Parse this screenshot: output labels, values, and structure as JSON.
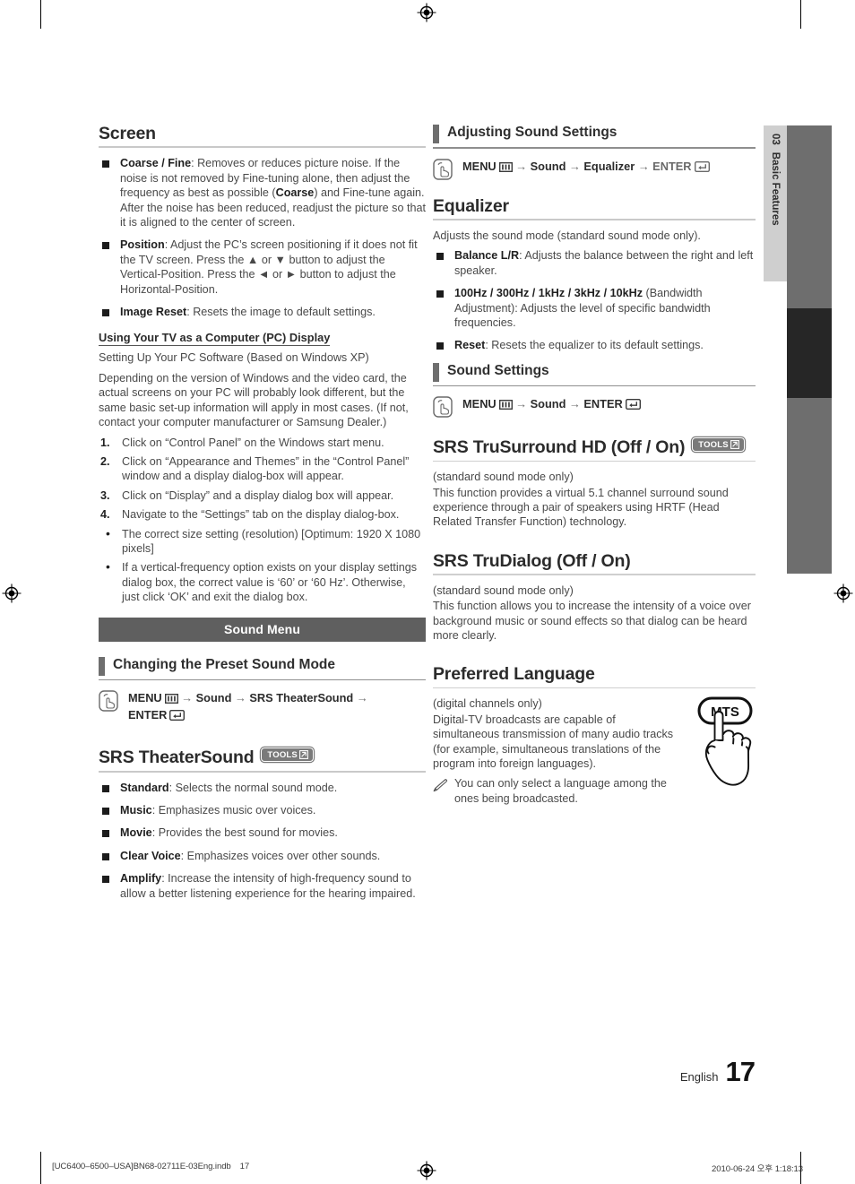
{
  "page": {
    "number": "17",
    "language_label": "English",
    "thumb_tab": {
      "chapter_number": "03",
      "chapter_title": "Basic Features"
    }
  },
  "footer": {
    "file_name": "[UC6400–6500–USA]BN68-02711E-03Eng.indb",
    "page_ref": "17",
    "timestamp": "2010-06-24   오후 1:18:13"
  },
  "left_column": {
    "screen": {
      "heading": "Screen",
      "bullets": [
        {
          "term": "Coarse / Fine",
          "text": ": Removes or reduces picture noise. If the noise is not removed by Fine-tuning alone, then adjust the frequency as best as possible (",
          "term2": "Coarse",
          "text2": ") and Fine-tune again. After the noise has been reduced, readjust the picture so that it is aligned to the center of screen."
        },
        {
          "term": "Position",
          "text": ": Adjust the PC’s screen positioning if it does not fit the TV screen. Press the ▲ or ▼ button to adjust the Vertical-Position. Press the ◄ or ► button to adjust the Horizontal-Position."
        },
        {
          "term": "Image Reset",
          "text": ": Resets the image to default settings."
        }
      ]
    },
    "pc_display": {
      "sub_heading": "Using Your TV as a Computer (PC) Display",
      "intro_line": "Setting Up Your PC Software (Based on Windows XP)",
      "paragraph": "Depending on the version of Windows and the video card, the actual screens on your PC will probably look different, but the same basic set-up information will apply in most cases. (If not, contact your computer manufacturer or Samsung Dealer.)",
      "steps": [
        {
          "num": "1.",
          "text": "Click on “Control Panel” on the Windows start menu."
        },
        {
          "num": "2.",
          "text": "Click on “Appearance and Themes” in the “Control Panel” window and a display dialog-box will appear."
        },
        {
          "num": "3.",
          "text": "Click on “Display” and a display dialog box will appear."
        },
        {
          "num": "4.",
          "text": "Navigate to the “Settings” tab on the display dialog-box."
        }
      ],
      "notes": [
        "The correct size setting (resolution) [Optimum: 1920 X 1080 pixels]",
        "If a vertical-frequency option exists on your display settings dialog box, the correct value is ‘60’ or ‘60 Hz’. Otherwise, just click ‘OK’ and exit the dialog box."
      ]
    },
    "sound_menu_band": "Sound Menu",
    "preset_sound_mode": {
      "section_title": "Changing the Preset Sound Mode",
      "path": {
        "menu_label": "MENU",
        "menu_icon": "menu-grid-icon",
        "arrow": "→",
        "step2": "Sound",
        "step3": "SRS TheaterSound",
        "enter_label": "ENTER",
        "enter_icon": "enter-key-icon"
      }
    },
    "theater_sound": {
      "heading": "SRS TheaterSound",
      "badge": "TOOLS",
      "bullets": [
        {
          "term": "Standard",
          "text": ": Selects the normal sound mode."
        },
        {
          "term": "Music",
          "text": ": Emphasizes music over voices."
        },
        {
          "term": "Movie",
          "text": ": Provides the best sound for movies."
        },
        {
          "term": "Clear Voice",
          "text": ": Emphasizes voices over other sounds."
        },
        {
          "term": "Amplify",
          "text": ": Increase the intensity of high-frequency sound to allow a better listening experience for the hearing impaired."
        }
      ]
    }
  },
  "right_column": {
    "adjusting_sound": {
      "section_title": "Adjusting Sound Settings",
      "path": {
        "menu_label": "MENU",
        "arrow": "→",
        "step2": "Sound",
        "step3": "Equalizer",
        "enter_label": "ENTER"
      }
    },
    "equalizer": {
      "heading": "Equalizer",
      "intro": "Adjusts the sound mode (standard sound mode only).",
      "bullets": [
        {
          "term": "Balance L/R",
          "text": ": Adjusts the balance between the right and left speaker."
        },
        {
          "term": "100Hz / 300Hz / 1kHz / 3kHz / 10kHz",
          "text": " (Bandwidth Adjustment): Adjusts the level of specific bandwidth frequencies."
        },
        {
          "term": "Reset",
          "text": ": Resets the equalizer to its default settings."
        }
      ]
    },
    "sound_settings": {
      "section_title": "Sound Settings",
      "path": {
        "menu_label": "MENU",
        "arrow": "→",
        "step2": "Sound",
        "enter_label": "ENTER"
      }
    },
    "trusurround": {
      "heading": "SRS TruSurround HD (Off / On)",
      "badge": "TOOLS",
      "note": "(standard sound mode only)",
      "body": "This function provides a virtual 5.1 channel surround sound experience through a pair of speakers using HRTF (Head Related Transfer Function) technology."
    },
    "trudialog": {
      "heading": "SRS TruDialog (Off / On)",
      "note": "(standard sound mode only)",
      "body": "This function allows you to increase the intensity of a voice over background music or sound effects so that dialog can be heard more clearly."
    },
    "preferred_language": {
      "heading": "Preferred Language",
      "note": "(digital channels only)",
      "body": "Digital-TV broadcasts are capable of simultaneous transmission of many audio tracks (for example, simultaneous translations of the program into foreign languages).",
      "tip": "You can only select a language among the ones being broadcasted.",
      "remote_button_label": "MTS"
    }
  },
  "colors": {
    "band_bg": "#5f5f5f",
    "tab_light": "#cfcfcf",
    "tab_grey": "#6e6e6e",
    "tab_dark": "#262626",
    "tools_badge": "#7a7a7a",
    "body_text": "#494949"
  }
}
